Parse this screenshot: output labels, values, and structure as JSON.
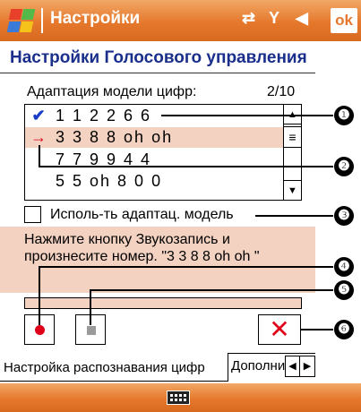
{
  "titlebar": {
    "title": "Настройки",
    "icons": [
      "windows-start-icon",
      "sync-icon",
      "signal-icon",
      "volume-icon"
    ],
    "ok_label": "ok"
  },
  "header": {
    "title": "Настройки Голосового управления"
  },
  "adaptation": {
    "label": "Адаптация модели цифр:",
    "count": "2/10"
  },
  "list": {
    "rows": [
      {
        "mark": "✔",
        "value": "1 1 2 2 6 6"
      },
      {
        "mark": "→",
        "value": "3 3 8 8 oh oh"
      },
      {
        "mark": "",
        "value": "7 7 9 9 4 4"
      },
      {
        "mark": "",
        "value": "5 5 oh 8 0 0"
      }
    ]
  },
  "checkbox": {
    "label": "Исполь-ть адаптац. модель",
    "checked": false
  },
  "instruction": {
    "text": "Нажмите кнопку Звукозапись и произнесите номер. \"3 3 8 8 oh oh \""
  },
  "buttons": {
    "record": "record-icon",
    "stop": "stop-icon",
    "delete": "✕"
  },
  "tabs": {
    "active": "Настройка распознавания цифр",
    "second": "Дополнительно"
  },
  "callouts": [
    "❶",
    "❷",
    "❸",
    "❹",
    "❺",
    "❻"
  ],
  "colors": {
    "bar": "#e5782c",
    "title_text": "#1a2f8c",
    "highlight": "#f3d2c1",
    "accent_red": "#e0001a",
    "check_blue": "#1a3cc8"
  }
}
